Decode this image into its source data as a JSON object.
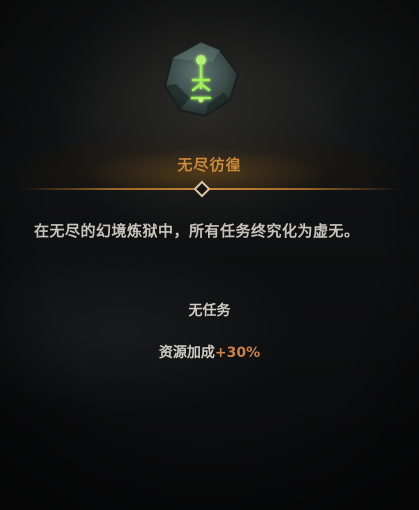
{
  "card": {
    "icon": "green-rune-stone-icon",
    "title": "无尽彷徨",
    "description": "在无尽的幻境炼狱中，所有任务终究化为虚无。",
    "task": "无任务",
    "bonus_label": "资源加成",
    "bonus_value": "+30%"
  },
  "colors": {
    "title": "#c98a3c",
    "text": "#c8c4bc",
    "bonus_value": "#c9824a",
    "rune_glow": "#8ee04a",
    "background": "#0b0c0d"
  }
}
